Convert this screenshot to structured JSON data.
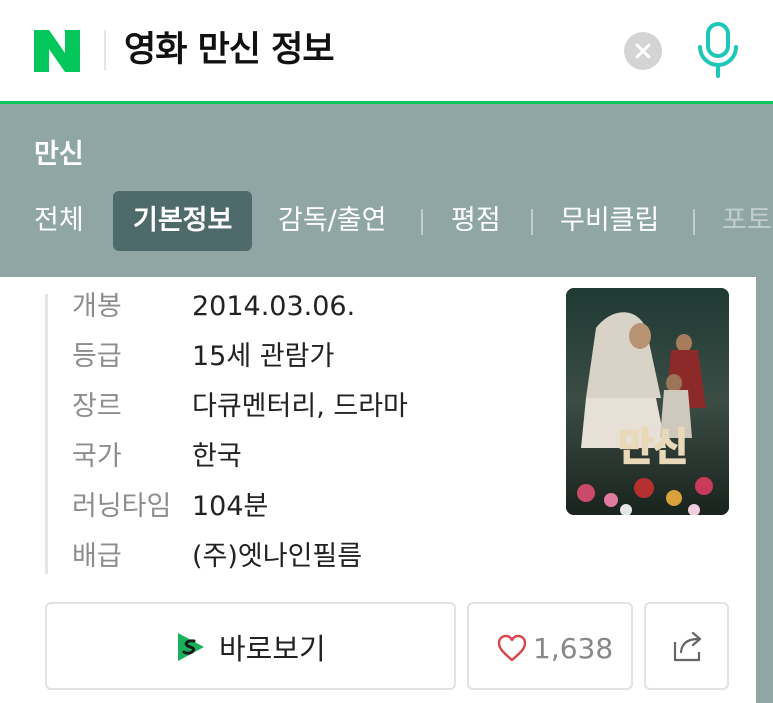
{
  "header": {
    "logo_letter": "N",
    "search_query": "영화 만신 정보",
    "brand_color": "#03c75a"
  },
  "band": {
    "title": "만신",
    "tabs": [
      {
        "label": "전체",
        "active": false
      },
      {
        "label": "기본정보",
        "active": true
      },
      {
        "label": "감독/출연",
        "active": false
      },
      {
        "label": "평점",
        "active": false
      },
      {
        "label": "무비클립",
        "active": false
      },
      {
        "label": "포토",
        "active": false
      }
    ]
  },
  "info": [
    {
      "key": "개봉",
      "value": "2014.03.06."
    },
    {
      "key": "등급",
      "value": "15세 관람가"
    },
    {
      "key": "장르",
      "value": "다큐멘터리, 드라마"
    },
    {
      "key": "국가",
      "value": "한국"
    },
    {
      "key": "러닝타임",
      "value": "104분"
    },
    {
      "key": "배급",
      "value": "(주)엣나인필름"
    }
  ],
  "poster": {
    "title_text": "만신"
  },
  "actions": {
    "watch_label": "바로보기",
    "like_count": "1,638"
  },
  "icons": [
    "clear-icon",
    "mic-icon",
    "play-s-icon",
    "heart-icon",
    "share-icon"
  ]
}
